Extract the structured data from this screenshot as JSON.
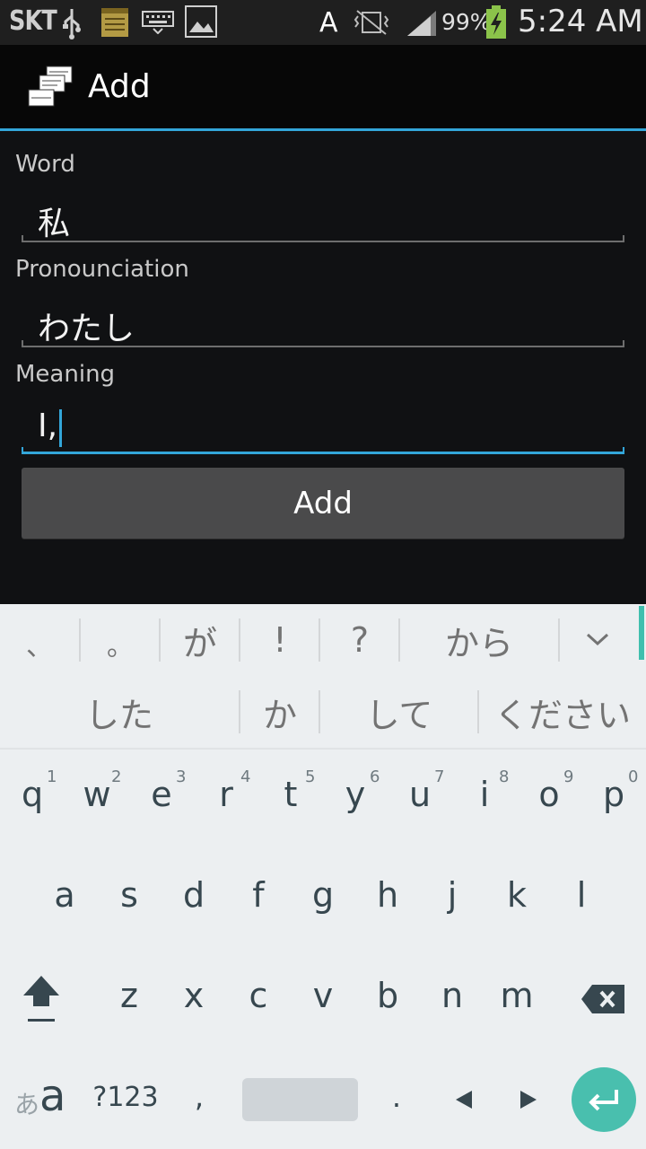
{
  "status_bar": {
    "carrier": "SKT",
    "battery_percent": "99%",
    "time": "5:24 AM",
    "input_indicator": "A",
    "icons": [
      "usb-icon",
      "notes-icon",
      "keyboard-icon",
      "gallery-icon",
      "vibrate-off-icon",
      "signal-icon",
      "battery-charging-icon"
    ]
  },
  "action_bar": {
    "title": "Add",
    "icon": "app-icon"
  },
  "form": {
    "word_label": "Word",
    "word_value": "私",
    "pronunciation_label": "Pronounciation",
    "pronunciation_value": "わたし",
    "meaning_label": "Meaning",
    "meaning_value": "I,",
    "add_button_label": "Add"
  },
  "keyboard": {
    "suggestions_row1": [
      "、",
      "。",
      "が",
      "!",
      "?",
      "から"
    ],
    "suggestions_row2": [
      "した",
      "か",
      "して",
      "ください"
    ],
    "row_q": [
      "q",
      "w",
      "e",
      "r",
      "t",
      "y",
      "u",
      "i",
      "o",
      "p"
    ],
    "row_q_hints": [
      "1",
      "2",
      "3",
      "4",
      "5",
      "6",
      "7",
      "8",
      "9",
      "0"
    ],
    "row_a": [
      "a",
      "s",
      "d",
      "f",
      "g",
      "h",
      "j",
      "k",
      "l"
    ],
    "row_z": [
      "z",
      "x",
      "c",
      "v",
      "b",
      "n",
      "m"
    ],
    "lang_key_small": "あ",
    "lang_key_large": "a",
    "symbols_key": "?123",
    "comma_key": ",",
    "period_key": ".",
    "accent_color": "#49bfae"
  }
}
